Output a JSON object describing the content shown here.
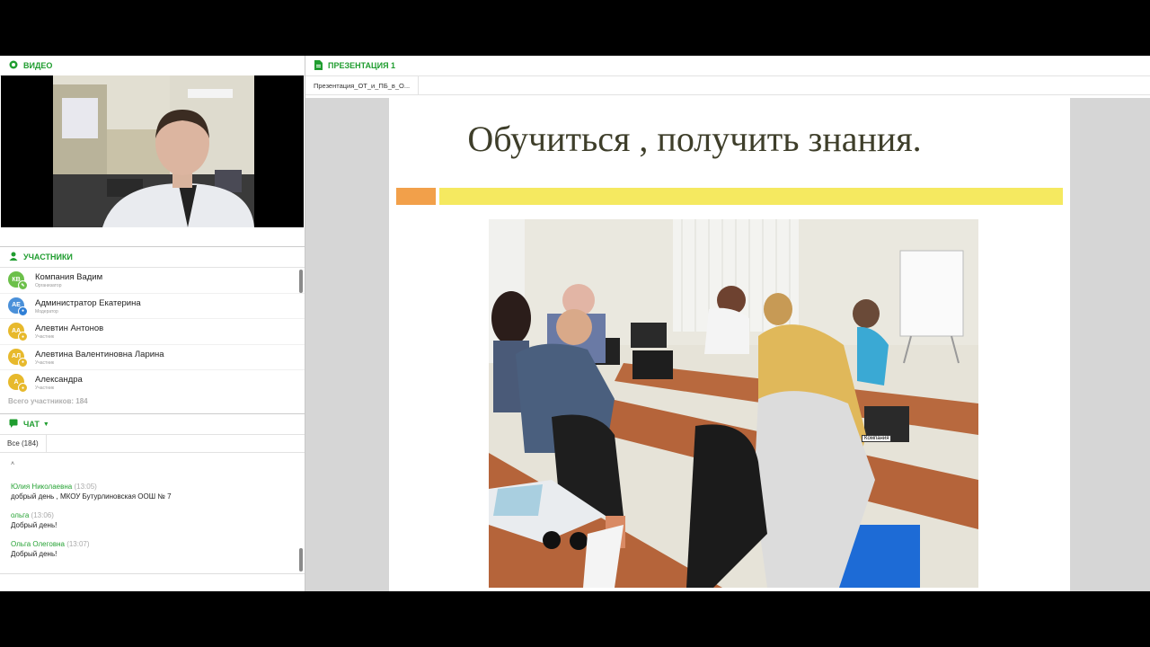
{
  "video": {
    "title": "ВИДЕО"
  },
  "participants": {
    "title": "УЧАСТНИКИ",
    "items": [
      {
        "initials": "КВ",
        "name": "Компания Вадим",
        "role": "Организатор",
        "color": "#6cc04a"
      },
      {
        "initials": "АЕ",
        "name": "Администратор Екатерина",
        "role": "Модератор",
        "color": "#4a90d9"
      },
      {
        "initials": "АА",
        "name": "Алевтин Антонов",
        "role": "Участник",
        "color": "#e7b92c"
      },
      {
        "initials": "АЛ",
        "name": "Алевтина Валентиновна Ларина",
        "role": "Участник",
        "color": "#e7b92c"
      },
      {
        "initials": "А",
        "name": "Александра",
        "role": "Участник",
        "color": "#e7b92c"
      }
    ],
    "total": "Всего участников: 184"
  },
  "chat": {
    "title": "ЧАТ",
    "tab_all": "Все (184)",
    "messages": [
      {
        "author": "Юлия Николаевна",
        "time": "(13:05)",
        "text": "добрый день , МКОУ Бутурлиновская ООШ № 7"
      },
      {
        "author": "ольга",
        "time": "(13:06)",
        "text": "Добрый день!"
      },
      {
        "author": "Ольга Олеговна",
        "time": "(13:07)",
        "text": "Добрый день!"
      }
    ]
  },
  "presentation": {
    "title": "ПРЕЗЕНТАЦИЯ 1",
    "file_tab": "Презентация_ОТ_и_ПБ_в_О...",
    "slide_title": "Обучиться , получить знания.",
    "cursor_label": "Компания"
  },
  "colors": {
    "accent": "#1f9d2f",
    "orange": "#f2a04a",
    "yellow": "#f5e960"
  }
}
